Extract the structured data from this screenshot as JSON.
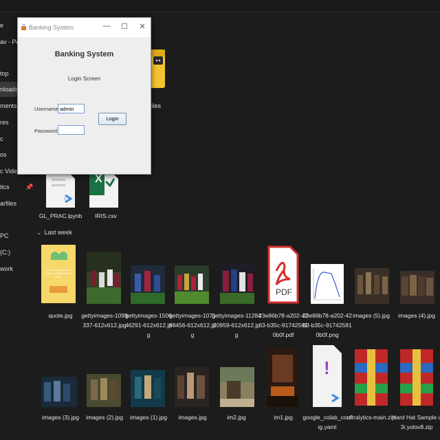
{
  "nav": {
    "items": [
      {
        "label": "e",
        "top": 0
      },
      {
        "label": "av - Pers",
        "top": 0
      },
      {
        "label": "top",
        "top": 0
      },
      {
        "label": "nloads",
        "top": 0
      },
      {
        "label": "ments",
        "top": 0
      },
      {
        "label": "res",
        "top": 0
      },
      {
        "label": "c",
        "top": 0
      },
      {
        "label": "os",
        "top": 0
      },
      {
        "label": "c Videos",
        "top": 0
      },
      {
        "label": "tics",
        "top": 0
      },
      {
        "label": "arfiles",
        "top": 0
      },
      {
        "label": "PC",
        "top": 0
      },
      {
        "label": "(C:)",
        "top": 0
      },
      {
        "label": "work",
        "top": 0
      }
    ],
    "pin_glyph": "📌"
  },
  "section": {
    "chevron": "⌄",
    "label": "Last week"
  },
  "top_files": {
    "folder_label": "rfiles",
    "gl_prac": "GL_PRAC.ipynb",
    "iris": "IRIS.csv",
    "iris_badge": "X"
  },
  "files_row1": [
    {
      "name": "quote.jpg",
      "caption": "Tell us if what you do makes a difference. It does."
    },
    {
      "name": "gettyimages-1099337-612x612.jpg"
    },
    {
      "name": "gettyimages-150646291-612x612.jpg"
    },
    {
      "name": "gettyimages-107198456-612x612.jpg"
    },
    {
      "name": "gettyimages-1128420959-612x612.jpg"
    },
    {
      "name": "23e86b78-a202-4263-b35c-917425810b0f.pdf",
      "badge": "PDF"
    },
    {
      "name": "23e86b78-a202-4263-b35c-917425810b0f.png"
    },
    {
      "name": "images (5).jpg"
    },
    {
      "name": "images (4).jpg"
    }
  ],
  "files_row2": [
    {
      "name": "images (3).jpg"
    },
    {
      "name": "images (2).jpg"
    },
    {
      "name": "images (1).jpg"
    },
    {
      "name": "images.jpg"
    },
    {
      "name": "im2.jpg"
    },
    {
      "name": "im1.jpg"
    },
    {
      "name": "google_colab_config.yaml",
      "badge": "!"
    },
    {
      "name": "ultralytics-main.zip"
    },
    {
      "name": "Hard Hat Sample.v3i.yolov8.zip"
    }
  ],
  "dialog": {
    "title": "Banking System",
    "heading": "Banking System",
    "subheading": "Login Screen",
    "username_label": "Username:",
    "username_value": "admin",
    "password_label": "Password:",
    "password_value": "",
    "login_label": "Login",
    "minimize": "—",
    "maximize": "☐",
    "close": "✕"
  },
  "colors": {
    "background": "#1c1c1c",
    "folder_yellow": "#f4c430",
    "pdf_red": "#d32f2f",
    "excel_green": "#1e7145"
  }
}
